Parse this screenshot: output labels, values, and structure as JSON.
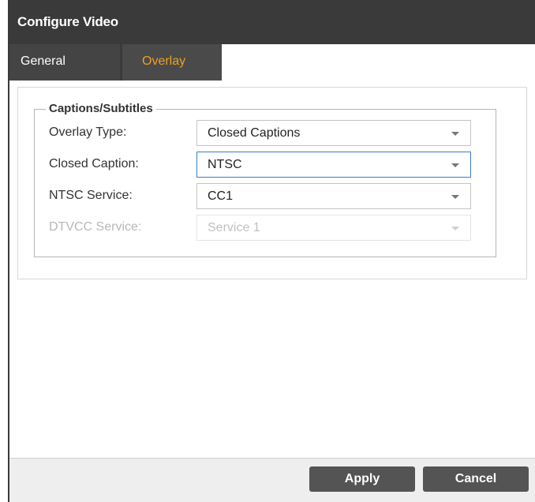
{
  "dialog": {
    "title": "Configure Video"
  },
  "tabs": [
    {
      "label": "General",
      "active": false
    },
    {
      "label": "Overlay",
      "active": true
    }
  ],
  "captions": {
    "legend": "Captions/Subtitles",
    "fields": [
      {
        "label": "Overlay Type:",
        "value": "Closed Captions",
        "enabled": true
      },
      {
        "label": "Closed Caption:",
        "value": "NTSC",
        "enabled": true,
        "focused": true
      },
      {
        "label": "NTSC Service:",
        "value": "CC1",
        "enabled": true
      },
      {
        "label": "DTVCC Service:",
        "value": "Service 1",
        "enabled": false
      }
    ]
  },
  "footer": {
    "apply_label": "Apply",
    "cancel_label": "Cancel"
  },
  "colors": {
    "active_tab_text": "#f0a020",
    "chrome": "#3a3a3a",
    "button": "#545454"
  }
}
